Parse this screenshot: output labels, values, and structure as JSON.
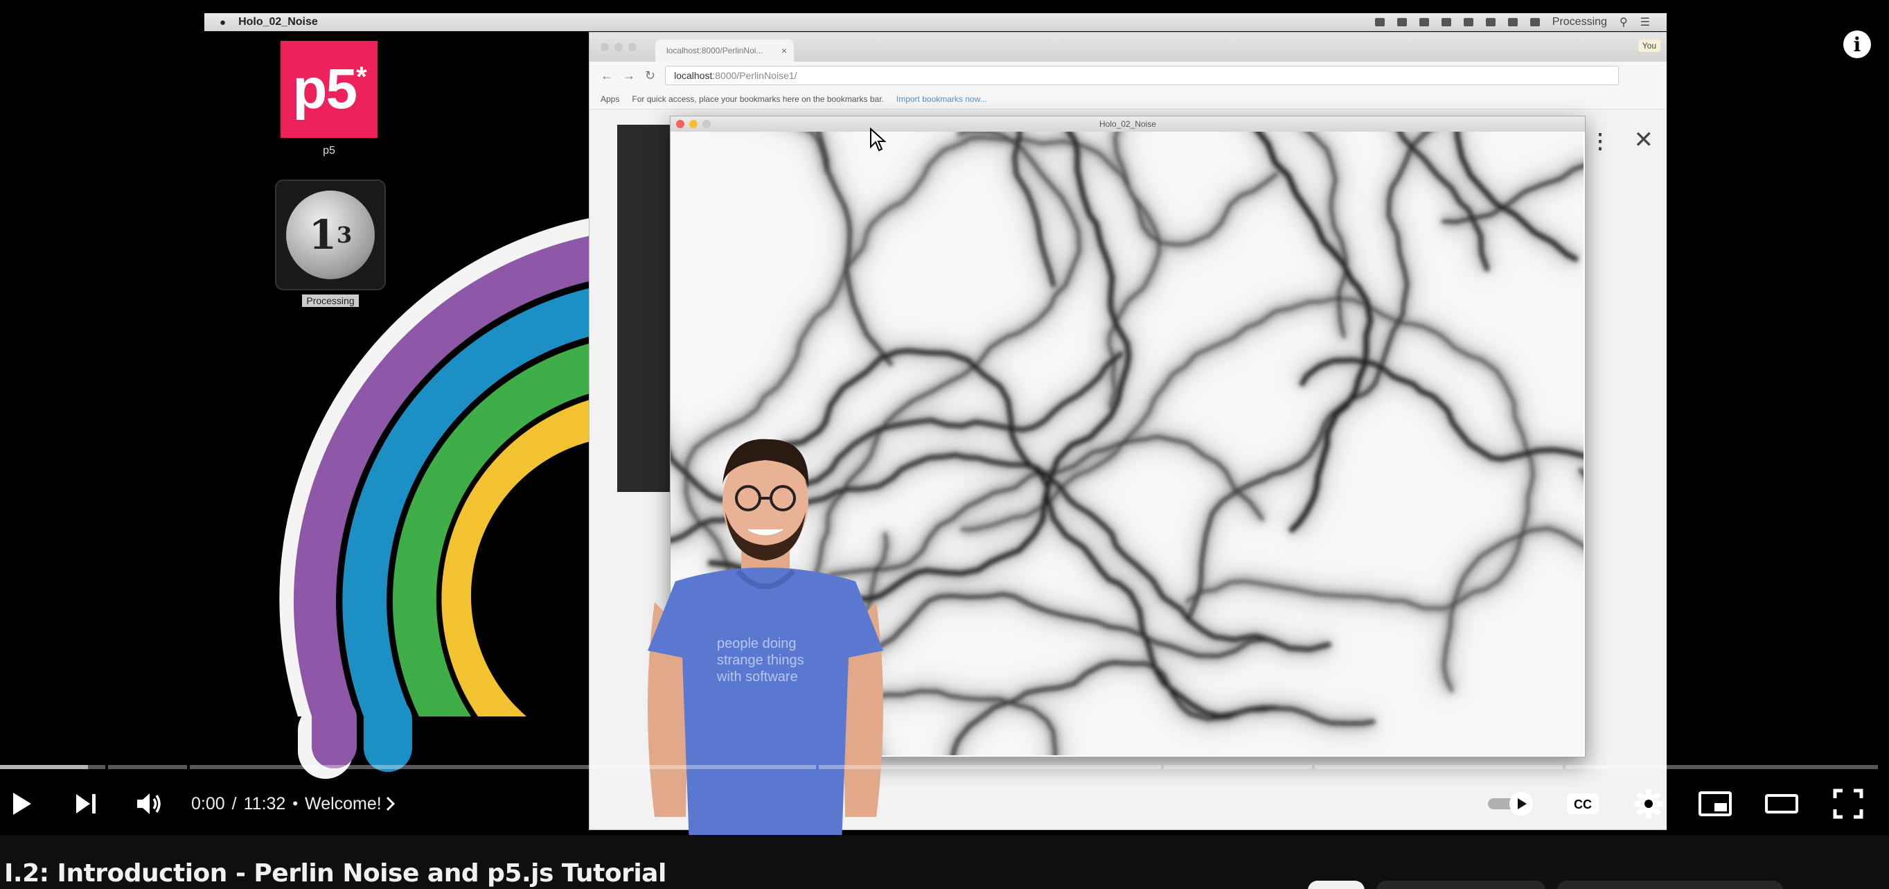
{
  "desktop": {
    "menubar_app": "Holo_02_Noise",
    "menubar_right_app": "Processing",
    "p5_icon_label": "p5",
    "processing_icon_label": "Processing"
  },
  "browser": {
    "tab_title": "localhost:8000/PerlinNoi...",
    "url_host": "localhost",
    "url_path": ":8000/PerlinNoise1/",
    "bookmarks_apps": "Apps",
    "bookmarks_hint": "For quick access, place your bookmarks here on the bookmarks bar.",
    "bookmarks_link": "Import bookmarks now...",
    "user_chip": "You"
  },
  "sketch": {
    "window_title": "Holo_02_Noise"
  },
  "presenter": {
    "shirt_text": "people doing strange things with software"
  },
  "player": {
    "current_time": "0:00",
    "duration": "11:32",
    "separator": "/",
    "chapter_dot": "•",
    "chapter": "Welcome!",
    "progress_fraction": 0.0,
    "autoplay": "on"
  },
  "video": {
    "title": "I.2: Introduction - Perlin Noise and p5.js Tutorial"
  },
  "colors": {
    "p5_pink": "#ed225d",
    "rainbow_purple": "#8e57a8",
    "rainbow_blue": "#1c8fc4",
    "rainbow_green": "#3fae49",
    "rainbow_yellow": "#f2c230",
    "shirt_blue": "#5a78d0"
  }
}
